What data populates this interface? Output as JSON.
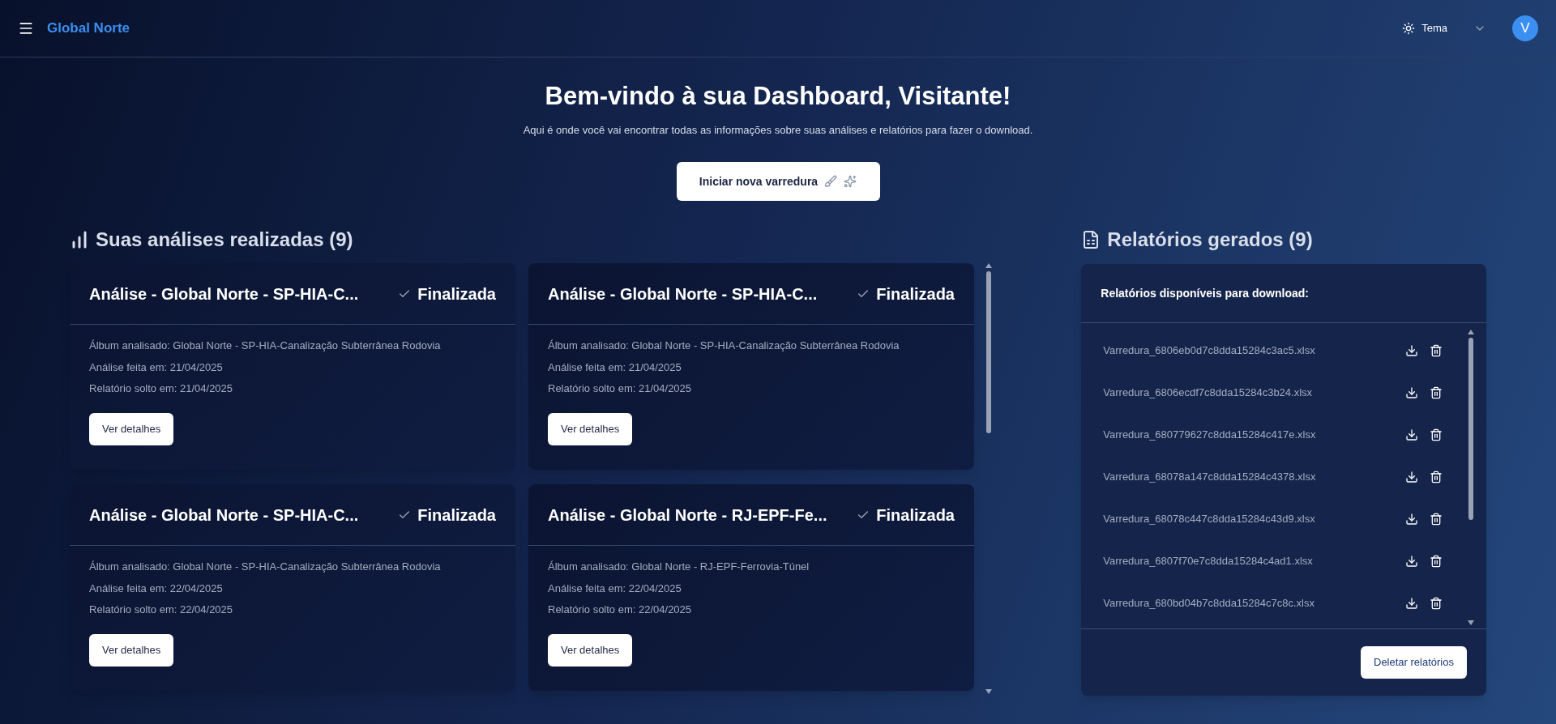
{
  "header": {
    "brand": "Global Norte",
    "theme_label": "Tema",
    "avatar": "V"
  },
  "welcome": {
    "title": "Bem-vindo à sua Dashboard, Visitante!",
    "subtitle": "Aqui é onde você vai encontrar todas as informações sobre suas análises e relatórios para fazer o download.",
    "action": "Iniciar nova varredura"
  },
  "analyses": {
    "heading": "Suas análises realizadas (9)",
    "cards": [
      {
        "title": "Análise - Global Norte - SP-HIA-C...",
        "status": "Finalizada",
        "album": "Álbum analisado: Global Norte - SP-HIA-Canalização Subterrânea Rodovia",
        "analyzed": "Análise feita em: 21/04/2025",
        "released": "Relatório solto em: 21/04/2025",
        "button": "Ver detalhes"
      },
      {
        "title": "Análise - Global Norte - SP-HIA-C...",
        "status": "Finalizada",
        "album": "Álbum analisado: Global Norte - SP-HIA-Canalização Subterrânea Rodovia",
        "analyzed": "Análise feita em: 21/04/2025",
        "released": "Relatório solto em: 21/04/2025",
        "button": "Ver detalhes"
      },
      {
        "title": "Análise - Global Norte - SP-HIA-C...",
        "status": "Finalizada",
        "album": "Álbum analisado: Global Norte - SP-HIA-Canalização Subterrânea Rodovia",
        "analyzed": "Análise feita em: 22/04/2025",
        "released": "Relatório solto em: 22/04/2025",
        "button": "Ver detalhes"
      },
      {
        "title": "Análise - Global Norte - RJ-EPF-Fe...",
        "status": "Finalizada",
        "album": "Álbum analisado: Global Norte - RJ-EPF-Ferrovia-Túnel",
        "analyzed": "Análise feita em: 22/04/2025",
        "released": "Relatório solto em: 22/04/2025",
        "button": "Ver detalhes"
      }
    ]
  },
  "reports": {
    "heading": "Relatórios gerados (9)",
    "panel_title": "Relatórios disponíveis para download:",
    "files": [
      "Varredura_6806eb0d7c8dda15284c3ac5.xlsx",
      "Varredura_6806ecdf7c8dda15284c3b24.xlsx",
      "Varredura_680779627c8dda15284c417e.xlsx",
      "Varredura_68078a147c8dda15284c4378.xlsx",
      "Varredura_68078c447c8dda15284c43d9.xlsx",
      "Varredura_6807f70e7c8dda15284c4ad1.xlsx",
      "Varredura_680bd04b7c8dda15284c7c8c.xlsx"
    ],
    "delete_button": "Deletar relatórios"
  }
}
